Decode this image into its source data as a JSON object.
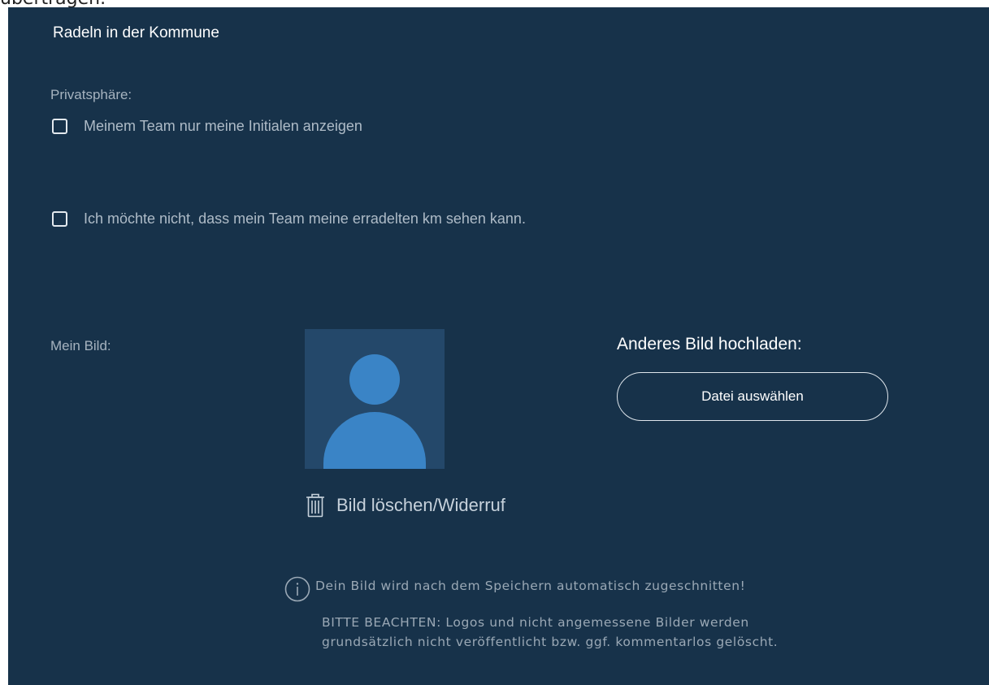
{
  "top_partial_text": "übertragen.",
  "header": {
    "title": "Radeln in der Kommune"
  },
  "privacy": {
    "label": "Privatsphäre:",
    "options": [
      {
        "label": "Meinem Team nur meine Initialen anzeigen",
        "checked": false
      },
      {
        "label": "Ich möchte nicht, dass mein Team meine erradelten km sehen kann.",
        "checked": false
      }
    ]
  },
  "picture": {
    "label": "Mein Bild:",
    "avatar_icon": "user-silhouette-icon",
    "upload_title": "Anderes Bild hochladen:",
    "file_button_label": "Datei auswählen",
    "delete_icon": "trash-icon",
    "delete_label": "Bild löschen/Widerruf"
  },
  "info": {
    "icon": "info-circle-icon",
    "crop_notice": "Dein Bild wird nach dem Speichern automatisch zugeschnitten!",
    "notice_lines": [
      "BITTE BEACHTEN: Logos und nicht angemessene Bilder werden",
      "grundsätzlich nicht veröffentlicht bzw. ggf. kommentarlos gelöscht."
    ]
  },
  "colors": {
    "panel_background": "#17324a",
    "avatar_background": "#24486a",
    "avatar_figure": "#3a84c6",
    "text_primary": "#ffffff",
    "text_secondary": "#a6b3bf"
  }
}
